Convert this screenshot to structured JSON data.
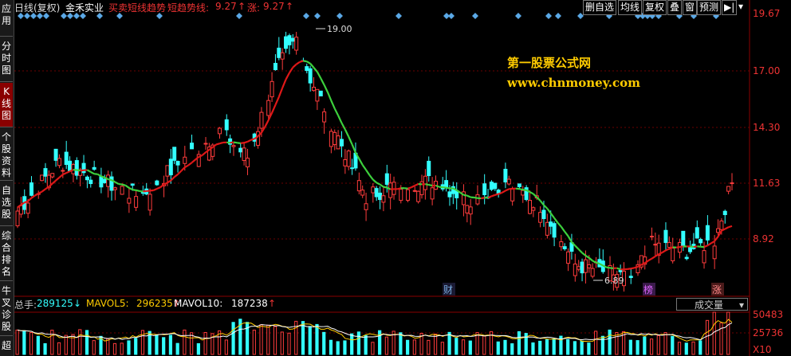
{
  "sidebar": {
    "tabs": [
      {
        "label": "应用",
        "active": false
      },
      {
        "label": "分时图",
        "active": false
      },
      {
        "label": "K线图",
        "active": true
      },
      {
        "label": "个股资料",
        "active": false
      },
      {
        "label": "自选股",
        "active": false
      },
      {
        "label": "综合排名",
        "active": false
      },
      {
        "label": "牛叉诊股",
        "active": false
      },
      {
        "label": "超",
        "active": false
      }
    ]
  },
  "header": {
    "period": "日线(复权)",
    "stock_name": "金禾实业",
    "indicator_name": "买卖短线趋势",
    "indicator_sub": "短趋势线:",
    "indicator_value": "9.27",
    "rise_label": "涨:",
    "rise_value": "9.27",
    "toolbar": {
      "delete_watch": "删自选",
      "ma_line": "均线",
      "restore": "复权",
      "overlay": "叠",
      "window": "窗",
      "forecast": "预测"
    }
  },
  "price_axis": {
    "labels": [
      "19.67",
      "17.00",
      "14.30",
      "11.63",
      "8.92"
    ]
  },
  "annotations": {
    "high_label": "19.00",
    "low_label": "6.89",
    "marker_cai": "财",
    "marker_bang": "榜",
    "marker_zhang": "涨"
  },
  "watermark": {
    "title": "第一股票公式网",
    "url": "www.chnmoney.com"
  },
  "volume": {
    "total_label": "总手:",
    "total_value": "289125",
    "mavol5_label": "MAVOL5:",
    "mavol5_value": "296235",
    "mavol10_label": "MAVOL10:",
    "mavol10_value": "187238",
    "selector": "成交量",
    "axis_labels": [
      "50483",
      "25736",
      "X10"
    ]
  },
  "colors": {
    "up": "#ff3c3c",
    "down": "#3ff",
    "ma_up": "#e01818",
    "ma_down": "#3dd13d",
    "diamond": "#5aa8e6",
    "accent": "#ffcc00"
  },
  "chart_data": {
    "type": "candlestick",
    "title": "",
    "ylim": [
      6.0,
      20.2
    ],
    "price_ticks": [
      19.67,
      17.0,
      14.3,
      11.63,
      8.92
    ],
    "high": 19.0,
    "low": 6.89,
    "last_close": 11.7,
    "volume_ticks": [
      50483,
      25736
    ],
    "volume_total": 289125,
    "mavol5": 296235,
    "mavol10": 187238
  }
}
